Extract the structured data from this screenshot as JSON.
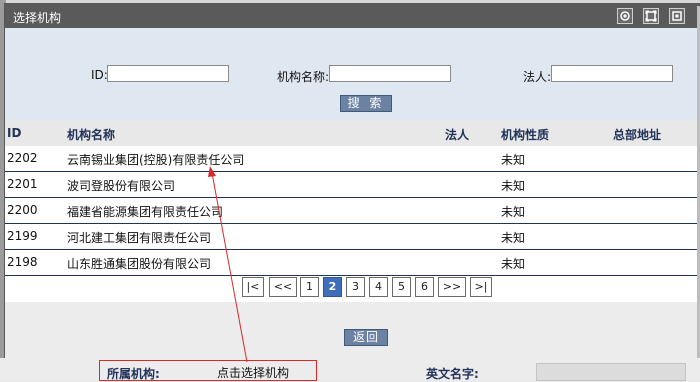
{
  "dialog": {
    "title": "选择机构",
    "search": {
      "id_label": "ID:",
      "id_value": "",
      "name_label": "机构名称:",
      "name_value": "",
      "legal_label": "法人:",
      "legal_value": "",
      "search_button": "搜 索"
    },
    "table": {
      "headers": [
        "ID",
        "机构名称",
        "法人",
        "机构性质",
        "总部地址"
      ],
      "rows": [
        {
          "id": "2202",
          "name": "云南锡业集团(控股)有限责任公司",
          "legal": "",
          "nature": "未知",
          "address": ""
        },
        {
          "id": "2201",
          "name": "波司登股份有限公司",
          "legal": "",
          "nature": "未知",
          "address": ""
        },
        {
          "id": "2200",
          "name": "福建省能源集团有限责任公司",
          "legal": "",
          "nature": "未知",
          "address": ""
        },
        {
          "id": "2199",
          "name": "河北建工集团有限责任公司",
          "legal": "",
          "nature": "未知",
          "address": ""
        },
        {
          "id": "2198",
          "name": "山东胜通集团股份有限公司",
          "legal": "",
          "nature": "未知",
          "address": ""
        }
      ]
    },
    "pager": {
      "first": "|<",
      "prev": "<<",
      "pages": [
        "1",
        "2",
        "3",
        "4",
        "5",
        "6"
      ],
      "current": "2",
      "next": ">>",
      "last": ">|"
    },
    "back_button": "返回"
  },
  "page_below": {
    "org_label": "所属机构:",
    "org_value": "点击选择机构",
    "english_name_label": "英文名字:"
  },
  "colors": {
    "titlebar": "#5a5a5a",
    "search_bg": "#dfe8f0",
    "button": "#6b82a2",
    "pager_active": "#3f6fb9",
    "annotation": "#d82a2a"
  }
}
